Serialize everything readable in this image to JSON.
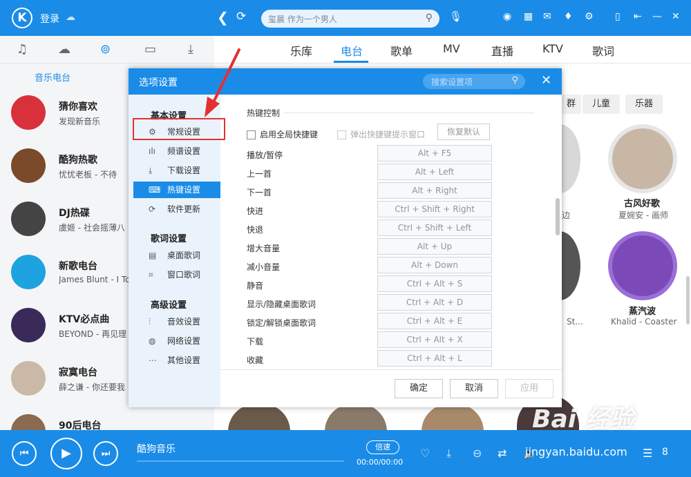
{
  "titlebar": {
    "logo": "K",
    "login": "登录",
    "search_placeholder": "玺晨 作为一个男人"
  },
  "sidebar": {
    "tabs": [
      "music-icon",
      "cloud-icon",
      "radio-icon",
      "device-icon",
      "download-icon"
    ],
    "subtitle": "音乐电台",
    "items": [
      {
        "name": "猜你喜欢",
        "sub": "发现新音乐",
        "color": "#d9313b"
      },
      {
        "name": "酷狗热歌",
        "sub": "忧忧老板 - 不待",
        "color": "#7a4a2a"
      },
      {
        "name": "DJ热碟",
        "sub": "虞姬 - 社会摇薄八",
        "color": "#444444"
      },
      {
        "name": "新歌电台",
        "sub": "James Blunt - I To",
        "color": "#1ea3e0"
      },
      {
        "name": "KTV必点曲",
        "sub": "BEYOND - 再见理",
        "color": "#3a2a5a"
      },
      {
        "name": "寂寞电台",
        "sub": "薛之谦 - 你还要我",
        "color": "#c9b9a6"
      },
      {
        "name": "90后电台",
        "sub": "",
        "color": "#8a6a50"
      }
    ]
  },
  "main": {
    "tabs": [
      "乐库",
      "电台",
      "歌单",
      "MV",
      "直播",
      "KTV",
      "歌词"
    ],
    "categories": [
      "群",
      "儿童",
      "乐器"
    ],
    "cards": [
      {
        "title": "古风好歌",
        "sub": "夏婉安 - 画师"
      },
      {
        "title": "蒸汽波",
        "sub": "Khalid - Coaster"
      }
    ],
    "partial": [
      "边",
      "St..."
    ]
  },
  "dialog": {
    "title": "选项设置",
    "search_placeholder": "搜索设置项",
    "nav": {
      "group1": "基本设置",
      "group1_items": [
        "常规设置",
        "频谱设置",
        "下载设置",
        "热键设置",
        "软件更新"
      ],
      "group2": "歌词设置",
      "group2_items": [
        "桌面歌词",
        "窗口歌词"
      ],
      "group3": "高级设置",
      "group3_items": [
        "音效设置",
        "网络设置",
        "其他设置"
      ]
    },
    "section": "热键控制",
    "enable_global": "启用全局快捷键",
    "popup_hint": "弹出快捷键提示窗口",
    "restore": "恢复默认",
    "hotkeys": [
      {
        "label": "播放/暂停",
        "key": "Alt + F5"
      },
      {
        "label": "上一首",
        "key": "Alt + Left"
      },
      {
        "label": "下一首",
        "key": "Alt + Right"
      },
      {
        "label": "快进",
        "key": "Ctrl + Shift + Right"
      },
      {
        "label": "快退",
        "key": "Ctrl + Shift + Left"
      },
      {
        "label": "增大音量",
        "key": "Alt + Up"
      },
      {
        "label": "减小音量",
        "key": "Alt + Down"
      },
      {
        "label": "静音",
        "key": "Ctrl + Alt + S"
      },
      {
        "label": "显示/隐藏桌面歌词",
        "key": "Ctrl + Alt + D"
      },
      {
        "label": "锁定/解锁桌面歌词",
        "key": "Ctrl + Alt + E"
      },
      {
        "label": "下载",
        "key": "Ctrl + Alt + X"
      },
      {
        "label": "收藏",
        "key": "Ctrl + Alt + L"
      }
    ],
    "ok": "确定",
    "cancel": "取消",
    "apply": "应用"
  },
  "player": {
    "song": "酷狗音乐",
    "speed": "倍速",
    "time": "00:00/00:00",
    "count": "8"
  },
  "watermark": {
    "brand": "Bai 经验",
    "url": "jingyan.baidu.com"
  }
}
